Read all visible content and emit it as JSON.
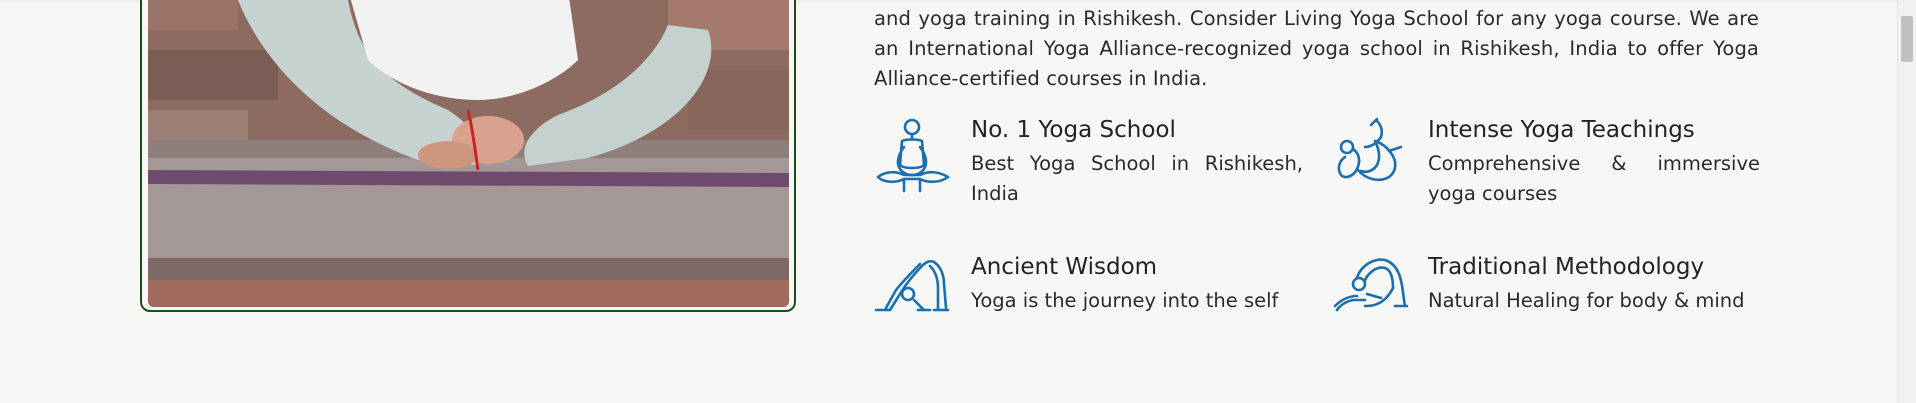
{
  "intro": {
    "text": "and yoga training in Rishikesh. Consider Living Yoga School for any yoga course. We are an International Yoga Alliance-recognized yoga school in Rishikesh, India to offer Yoga Alliance-certified courses in India."
  },
  "features": [
    {
      "title": "No. 1 Yoga School",
      "desc": "Best Yoga School in Rishikesh, India",
      "icon": "meditation-pose-icon"
    },
    {
      "title": "Intense Yoga Teachings",
      "desc": "Comprehensive & immersive yoga courses",
      "icon": "bow-pose-icon"
    },
    {
      "title": "Ancient Wisdom",
      "desc": "Yoga is the journey into the self",
      "icon": "downward-dog-pose-icon"
    },
    {
      "title": "Traditional Methodology",
      "desc": "Natural Healing for body & mind",
      "icon": "backbend-pose-icon"
    }
  ],
  "colors": {
    "icon": "#1a6fb0",
    "card_border": "#1d4d1d",
    "background": "#f7f7f5"
  }
}
